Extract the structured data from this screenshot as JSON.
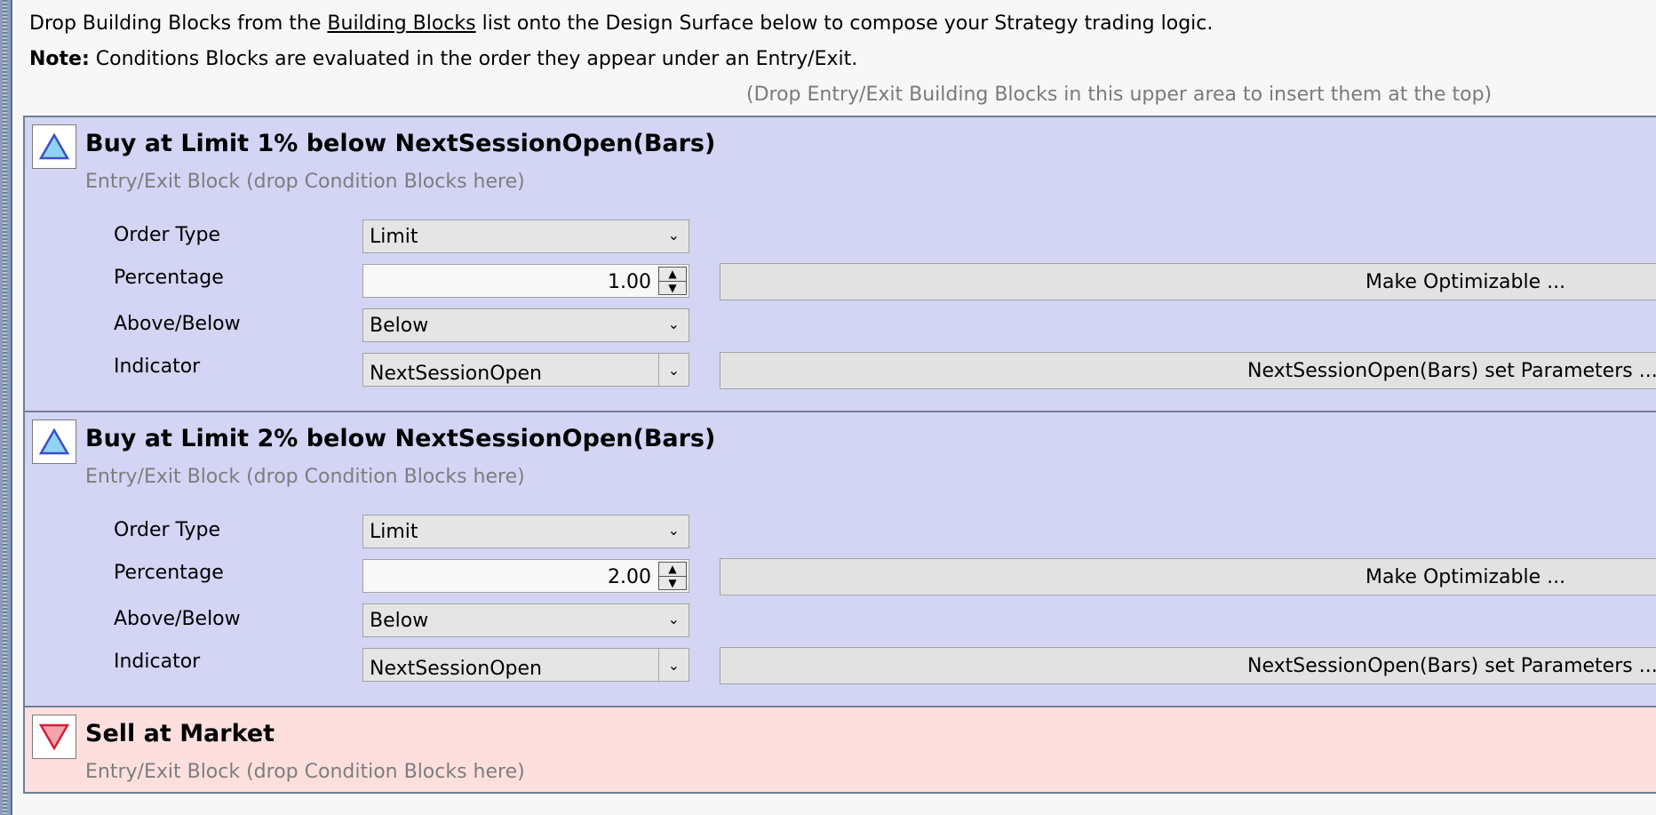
{
  "instructions": {
    "line1_pre": "Drop Building Blocks from the ",
    "line1_link": "Building Blocks",
    "line1_post": " list onto the Design Surface below to compose your Strategy trading logic.",
    "note_label": "Note:",
    "note_text": " Conditions Blocks are evaluated in the order they appear under an Entry/Exit.",
    "drop_hint": "(Drop Entry/Exit Building Blocks in this upper area to insert them at the top)"
  },
  "blocks": [
    {
      "title": "Buy at Limit 1% below NextSessionOpen(Bars)",
      "subtitle": "Entry/Exit Block (drop Condition Blocks here)",
      "icon": "triangle-up-icon",
      "order_type_label": "Order Type",
      "order_type": "Limit",
      "percentage_label": "Percentage",
      "percentage": "1.00",
      "above_below_label": "Above/Below",
      "above_below": "Below",
      "indicator_label": "Indicator",
      "indicator": "NextSessionOpen",
      "optimize_label": "Make Optimizable ...",
      "params_label": "NextSessionOpen(Bars) set Parameters ..."
    },
    {
      "title": "Buy at Limit 2% below NextSessionOpen(Bars)",
      "subtitle": "Entry/Exit Block (drop Condition Blocks here)",
      "icon": "triangle-up-icon",
      "order_type_label": "Order Type",
      "order_type": "Limit",
      "percentage_label": "Percentage",
      "percentage": "2.00",
      "above_below_label": "Above/Below",
      "above_below": "Below",
      "indicator_label": "Indicator",
      "indicator": "NextSessionOpen",
      "optimize_label": "Make Optimizable ...",
      "params_label": "NextSessionOpen(Bars) set Parameters ..."
    },
    {
      "title": "Sell at Market",
      "subtitle": "Entry/Exit Block (drop Condition Blocks here)",
      "icon": "triangle-down-icon"
    }
  ],
  "colors": {
    "entry_bg": "#d4d4f5",
    "exit_bg": "#fde0de",
    "up_icon_fill": "#8fd3f0",
    "up_icon_stroke": "#3a4fc7",
    "down_icon_fill": "#f5a3ad",
    "down_icon_stroke": "#d0203a"
  }
}
